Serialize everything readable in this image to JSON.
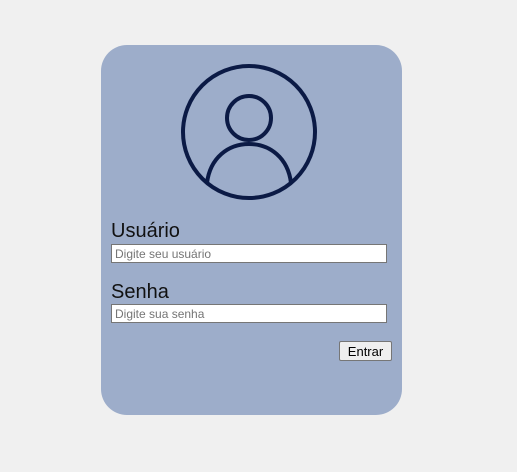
{
  "login": {
    "avatar_icon": "user-circle-icon",
    "colors": {
      "card_background": "#9dadca",
      "page_background": "#f0f0f0",
      "icon_stroke": "#0b1a45"
    },
    "username": {
      "label": "Usuário",
      "placeholder": "Digite seu usuário",
      "value": ""
    },
    "password": {
      "label": "Senha",
      "placeholder": "Digite sua senha",
      "value": ""
    },
    "submit_label": "Entrar"
  }
}
